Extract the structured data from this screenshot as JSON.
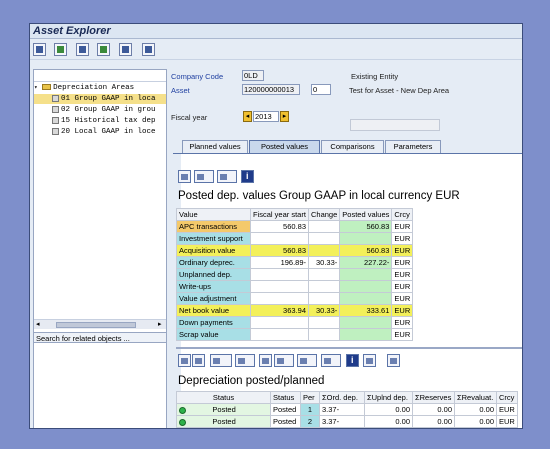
{
  "window": {
    "title": "Asset Explorer"
  },
  "toolbar": {
    "icons": [
      "display-icon",
      "edit-icon",
      "asset-icon",
      "hierarchy-icon",
      "list-icon"
    ]
  },
  "left_panel": {
    "tree": [
      {
        "label": "Depreciation Areas",
        "type": "folder"
      },
      {
        "label": "01 Group GAAP in loca",
        "type": "item",
        "selected": true
      },
      {
        "label": "02 Group GAAP in grou",
        "type": "item"
      },
      {
        "label": "15 Historical tax dep",
        "type": "item"
      },
      {
        "label": "20 Local GAAP in loce",
        "type": "item"
      }
    ],
    "footer": "Search for related objects ..."
  },
  "header": {
    "company_code_label": "Company Code",
    "company_code_value": "0LD",
    "company_code_text": "Existing Entity",
    "asset_label": "Asset",
    "asset_value": "120000000013",
    "asset_sub": "0",
    "asset_text": "Test for Asset - New Dep Area",
    "fiscal_year_label": "Fiscal year",
    "fiscal_year_value": "2013"
  },
  "tabs": [
    "Planned values",
    "Posted values",
    "Comparisons",
    "Parameters"
  ],
  "posted_panel": {
    "title": "Posted dep. values Group GAAP in local currency EUR",
    "columns": [
      "Value",
      "Fiscal year start",
      "Change",
      "Posted values",
      "Crcy"
    ],
    "rows": [
      {
        "name": "APC transactions",
        "start": "560.83",
        "change": "",
        "posted": "560.83",
        "crcy": "EUR"
      },
      {
        "name": "Investment support",
        "start": "",
        "change": "",
        "posted": "",
        "crcy": "EUR"
      },
      {
        "name": "Acquisition value",
        "start": "560.83",
        "change": "",
        "posted": "560.83",
        "crcy": "EUR"
      },
      {
        "name": "Ordinary deprec.",
        "start": "196.89-",
        "change": "30.33-",
        "posted": "227.22-",
        "crcy": "EUR"
      },
      {
        "name": "Unplanned dep.",
        "start": "",
        "change": "",
        "posted": "",
        "crcy": "EUR"
      },
      {
        "name": "Write-ups",
        "start": "",
        "change": "",
        "posted": "",
        "crcy": "EUR"
      },
      {
        "name": "Value adjustment",
        "start": "",
        "change": "",
        "posted": "",
        "crcy": "EUR"
      },
      {
        "name": "Net book value",
        "start": "363.94",
        "change": "30.33-",
        "posted": "333.61",
        "crcy": "EUR"
      },
      {
        "name": "Down payments",
        "start": "",
        "change": "",
        "posted": "",
        "crcy": "EUR"
      },
      {
        "name": "Scrap value",
        "start": "",
        "change": "",
        "posted": "",
        "crcy": "EUR"
      }
    ]
  },
  "depreciation_panel": {
    "title": "Depreciation posted/planned",
    "columns": [
      "Status",
      "Status",
      "Per",
      "ΣOrd. dep.",
      "ΣUplnd dep.",
      "ΣReserves",
      "ΣRevaluat.",
      "Crcy"
    ],
    "rows": [
      {
        "status": "Posted",
        "status2": "Posted",
        "per": "1",
        "ord": "3.37-",
        "uplnd": "0.00",
        "reserves": "0.00",
        "revaluat": "0.00",
        "crcy": "EUR"
      },
      {
        "status": "Posted",
        "status2": "Posted",
        "per": "2",
        "ord": "3.37-",
        "uplnd": "0.00",
        "reserves": "0.00",
        "revaluat": "0.00",
        "crcy": "EUR"
      }
    ]
  },
  "colors": {
    "background": "#7e8fcb",
    "window": "#e5ecf5",
    "highlight_yellow": "#f3f05a",
    "highlight_green": "#bff0c0",
    "label_blue": "#1f3fa0"
  }
}
